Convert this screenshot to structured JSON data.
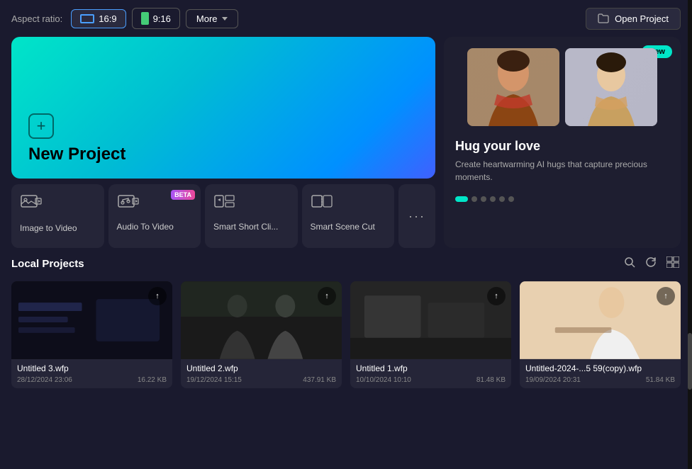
{
  "topbar": {
    "aspect_label": "Aspect ratio:",
    "ratio_16_9": "16:9",
    "ratio_9_16": "9:16",
    "more_label": "More",
    "open_project_label": "Open Project"
  },
  "new_project": {
    "title": "New Project"
  },
  "tools": [
    {
      "id": "image-to-video",
      "label": "Image to Video",
      "icon": "🎬",
      "beta": false
    },
    {
      "id": "audio-to-video",
      "label": "Audio To Video",
      "icon": "🎵",
      "beta": true
    },
    {
      "id": "smart-short-clip",
      "label": "Smart Short Cli...",
      "icon": "📊",
      "beta": false
    },
    {
      "id": "smart-scene-cut",
      "label": "Smart Scene Cut",
      "icon": "🎞",
      "beta": false
    }
  ],
  "feature_card": {
    "badge": "New",
    "title": "Hug your love",
    "description": "Create heartwarming AI hugs that capture precious moments.",
    "dots_count": 6,
    "active_dot": 0
  },
  "local_projects": {
    "title": "Local Projects",
    "projects": [
      {
        "name": "Untitled 3.wfp",
        "date": "28/12/2024 23:06",
        "size": "16.22 KB",
        "thumb_type": "dark"
      },
      {
        "name": "Untitled 2.wfp",
        "date": "19/12/2024 15:15",
        "size": "437.91 KB",
        "thumb_type": "medium"
      },
      {
        "name": "Untitled 1.wfp",
        "date": "10/10/2024 10:10",
        "size": "81.48 KB",
        "thumb_type": "dark"
      },
      {
        "name": "Untitled-2024-...5 59(copy).wfp",
        "date": "19/09/2024 20:31",
        "size": "51.84 KB",
        "thumb_type": "light"
      }
    ]
  }
}
